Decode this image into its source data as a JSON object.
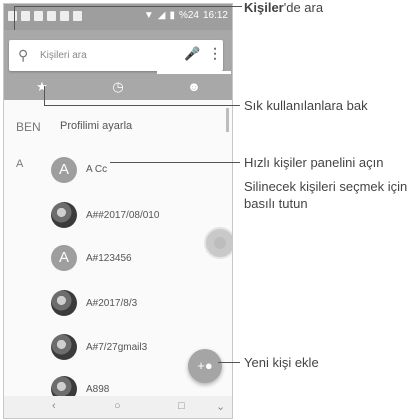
{
  "status_bar": {
    "battery": "%24",
    "time": "16:12"
  },
  "search": {
    "placeholder": "Kişileri ara"
  },
  "tabs": [
    {
      "icon": "star-icon"
    },
    {
      "icon": "clock-icon"
    },
    {
      "icon": "people-icon"
    }
  ],
  "me": {
    "section": "BEN",
    "label": "Profilimi ayarla"
  },
  "contacts": {
    "section": "A",
    "items": [
      {
        "avatar": "A",
        "name": "A Cc"
      },
      {
        "avatar": "",
        "name": "A##2017/08/010"
      },
      {
        "avatar": "A",
        "name": "A#123456"
      },
      {
        "avatar": "",
        "name": "A#2017/8/3"
      },
      {
        "avatar": "",
        "name": "A#7/27gmail3"
      },
      {
        "avatar": "",
        "name": "A898"
      }
    ]
  },
  "annotations": {
    "search_bold": "Kişiler",
    "search_rest": "'de ara",
    "favorites": "Sık kullanılanlara bak",
    "quick_panel": "Hızlı kişiler panelini açın",
    "delete_select_1": "Silinecek kişileri seçmek için",
    "delete_select_2": "basılı tutun",
    "add_contact": "Yeni kişi ekle"
  }
}
